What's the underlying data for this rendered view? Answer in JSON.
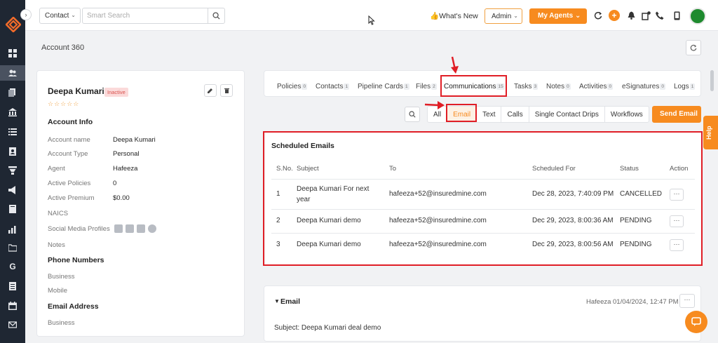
{
  "sidebar": {
    "items": [
      "dashboard-icon",
      "accounts-icon",
      "documents-icon",
      "bank-icon",
      "list-icon",
      "contact-card-icon",
      "filter-icon",
      "megaphone-icon",
      "book-icon",
      "chart-icon",
      "folder-icon",
      "google-icon",
      "report-icon",
      "calendar-icon",
      "mail-icon"
    ],
    "google_glyph": "G",
    "expand_glyph": "›"
  },
  "topbar": {
    "contact_select": "Contact",
    "search_placeholder": "Smart Search",
    "whats_new": "👍What's New",
    "admin_select": "Admin",
    "my_agents": "My Agents",
    "plus_glyph": "+"
  },
  "page": {
    "title": "Account 360"
  },
  "account": {
    "name": "Deepa Kumari",
    "status": "Inactive",
    "stars": "☆☆☆☆☆",
    "info_title": "Account Info",
    "fields": [
      {
        "label": "Account name",
        "value": "Deepa Kumari"
      },
      {
        "label": "Account Type",
        "value": "Personal"
      },
      {
        "label": "Agent",
        "value": "Hafeeza"
      },
      {
        "label": "Active Policies",
        "value": "0"
      },
      {
        "label": "Active Premium",
        "value": "$0.00"
      },
      {
        "label": "NAICS",
        "value": ""
      },
      {
        "label": "Social Media Profiles",
        "value": ""
      },
      {
        "label": "Notes",
        "value": ""
      }
    ],
    "phone_title": "Phone Numbers",
    "phone_fields": [
      "Business",
      "Mobile"
    ],
    "email_title": "Email Address",
    "email_fields": [
      "Business"
    ]
  },
  "tabs": [
    {
      "label": "Policies",
      "count": "0"
    },
    {
      "label": "Contacts",
      "count": "1"
    },
    {
      "label": "Pipeline Cards",
      "count": "1"
    },
    {
      "label": "Files",
      "count": "2"
    },
    {
      "label": "Communications",
      "count": "15"
    },
    {
      "label": "Tasks",
      "count": "3"
    },
    {
      "label": "Notes",
      "count": "0"
    },
    {
      "label": "Activities",
      "count": "0"
    },
    {
      "label": "eSignatures",
      "count": "0"
    },
    {
      "label": "Logs",
      "count": "1"
    }
  ],
  "subtabs": [
    "All",
    "Email",
    "Text",
    "Calls",
    "Single Contact Drips",
    "Workflows"
  ],
  "send_email": "Send Email",
  "scheduled": {
    "title": "Scheduled Emails",
    "columns": [
      "S.No.",
      "Subject",
      "To",
      "Scheduled For",
      "Status",
      "Action"
    ],
    "rows": [
      {
        "sno": "1",
        "subject_line1": "Deepa Kumari For next",
        "subject_line2": "year",
        "to": "hafeeza+52@insuredmine.com",
        "scheduled_for": "Dec 28, 2023, 7:40:09 PM",
        "status": "CANCELLED"
      },
      {
        "sno": "2",
        "subject_line1": "Deepa Kumari demo",
        "subject_line2": "",
        "to": "hafeeza+52@insuredmine.com",
        "scheduled_for": "Dec 29, 2023, 8:00:36 AM",
        "status": "PENDING"
      },
      {
        "sno": "3",
        "subject_line1": "Deepa Kumari demo",
        "subject_line2": "",
        "to": "hafeeza+52@insuredmine.com",
        "scheduled_for": "Dec 29, 2023, 8:00:56 AM",
        "status": "PENDING"
      }
    ],
    "action_glyph": "···"
  },
  "email_detail": {
    "title": "Email",
    "meta": "Hafeeza 01/04/2024, 12:47 PM",
    "subject": "Subject: Deepa Kumari deal demo"
  },
  "help": "Help",
  "colors": {
    "accent": "#f78b1f",
    "annotation": "#e01e26",
    "sidebar": "#1f2733"
  }
}
